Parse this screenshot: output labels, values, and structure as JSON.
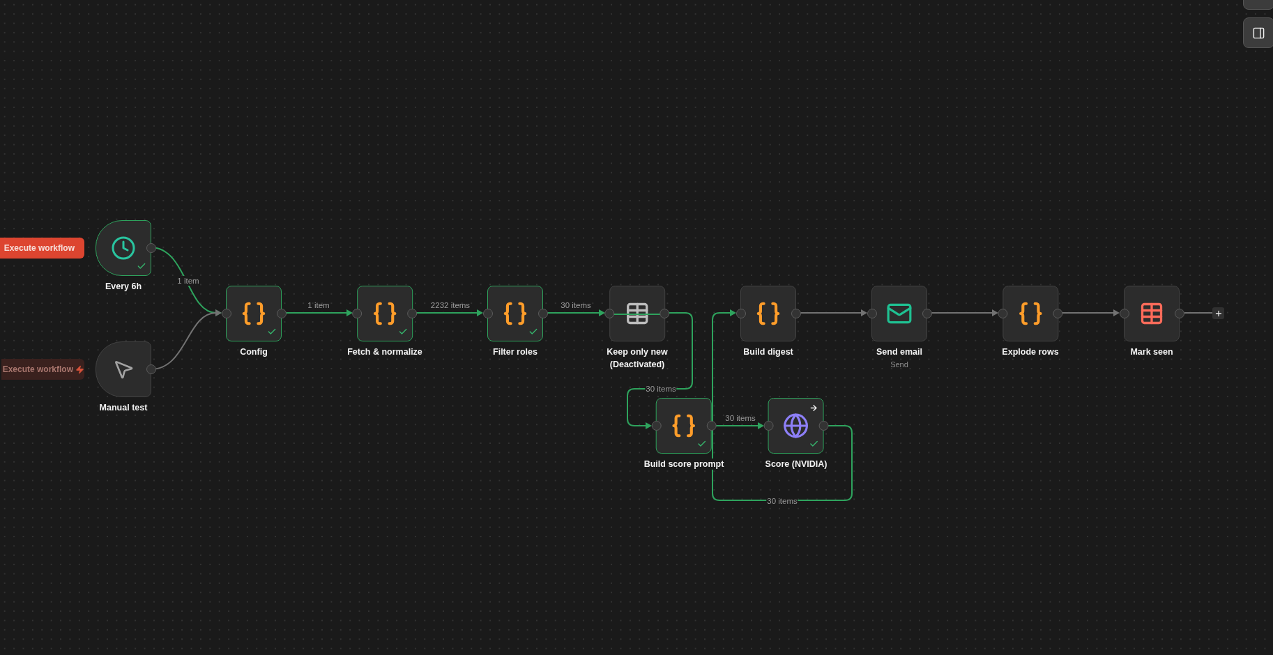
{
  "canvas": {
    "nodes": [
      {
        "label": "Every 6h",
        "kind": "schedule",
        "executed": true,
        "deactivated": false,
        "corner_arrow": false,
        "execute_button": {
          "label": "Execute workflow",
          "highlighted": true
        }
      },
      {
        "label": "Config",
        "kind": "code",
        "executed": true,
        "deactivated": false,
        "corner_arrow": false
      },
      {
        "label": "Fetch & normalize",
        "kind": "code",
        "executed": true,
        "deactivated": false,
        "corner_arrow": false
      },
      {
        "label": "Filter roles",
        "kind": "code",
        "executed": true,
        "deactivated": false,
        "corner_arrow": false
      },
      {
        "label": "Keep only new",
        "note": "(Deactivated)",
        "kind": "table",
        "executed": false,
        "deactivated": true,
        "corner_arrow": false
      },
      {
        "label": "Build digest",
        "kind": "code",
        "executed": false,
        "deactivated": false,
        "corner_arrow": false
      },
      {
        "label": "Send email",
        "subtitle": "Send",
        "kind": "email",
        "executed": false,
        "deactivated": false,
        "corner_arrow": false
      },
      {
        "label": "Explode rows",
        "kind": "code",
        "executed": false,
        "deactivated": false,
        "corner_arrow": false
      },
      {
        "label": "Mark seen",
        "kind": "table",
        "executed": false,
        "deactivated": false,
        "corner_arrow": false
      },
      {
        "label": "Manual test",
        "kind": "manual",
        "executed": false,
        "deactivated": false,
        "corner_arrow": false,
        "execute_button": {
          "label": "Execute workflow",
          "highlighted": false
        }
      },
      {
        "label": "Build score prompt",
        "kind": "code",
        "executed": true,
        "deactivated": false,
        "corner_arrow": false
      },
      {
        "label": "Score (NVIDIA)",
        "kind": "http",
        "executed": true,
        "deactivated": false,
        "corner_arrow": true
      }
    ],
    "connections": [
      {
        "label": "1 item",
        "executed": true
      },
      {
        "executed": false
      },
      {
        "label": "1 item",
        "executed": true
      },
      {
        "label": "2232 items",
        "executed": true
      },
      {
        "label": "30 items",
        "executed": true
      },
      {
        "label": "30 items",
        "executed": true
      },
      {
        "label": "30 items",
        "executed": true
      },
      {
        "label": "30 items",
        "executed": true
      },
      {
        "executed": false
      },
      {
        "executed": false
      },
      {
        "executed": false
      },
      {
        "executed": false
      }
    ]
  }
}
